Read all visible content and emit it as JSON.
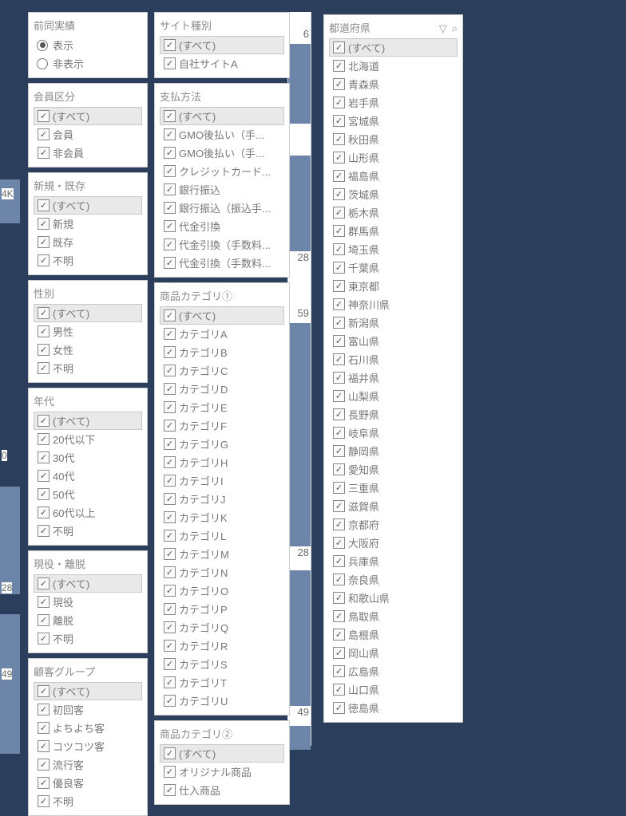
{
  "bg_numbers": {
    "n1": "4K",
    "n2": "0",
    "n3": "28",
    "n4": "49"
  },
  "right_numbers": {
    "r1": "6",
    "r2": "28",
    "r3": "59",
    "r4": "28",
    "r5": "49"
  },
  "panels": {
    "zenkai": {
      "title": "前同実績",
      "opt1": "表示",
      "opt2": "非表示"
    },
    "member": {
      "title": "会員区分",
      "all": "(すべて)",
      "items": [
        "会員",
        "非会員"
      ]
    },
    "shinki": {
      "title": "新規・既存",
      "all": "(すべて)",
      "items": [
        "新規",
        "既存",
        "不明"
      ]
    },
    "seibetsu": {
      "title": "性別",
      "all": "(すべて)",
      "items": [
        "男性",
        "女性",
        "不明"
      ]
    },
    "nendai": {
      "title": "年代",
      "all": "(すべて)",
      "items": [
        "20代以下",
        "30代",
        "40代",
        "50代",
        "60代以上",
        "不明"
      ]
    },
    "geneki": {
      "title": "現役・離脱",
      "all": "(すべて)",
      "items": [
        "現役",
        "離脱",
        "不明"
      ]
    },
    "group": {
      "title": "顧客グループ",
      "all": "(すべて)",
      "items": [
        "初回客",
        "よちよち客",
        "コツコツ客",
        "流行客",
        "優良客",
        "不明"
      ]
    },
    "site": {
      "title": "サイト種別",
      "all": "(すべて)",
      "items": [
        "自社サイトA"
      ]
    },
    "payment": {
      "title": "支払方法",
      "all": "(すべて)",
      "items": [
        "GMO後払い（手...",
        "GMO後払い（手...",
        "クレジットカード...",
        "銀行振込",
        "銀行振込（振込手...",
        "代金引換",
        "代金引換（手数料...",
        "代金引換（手数料..."
      ]
    },
    "cat1": {
      "title": "商品カテゴリ①",
      "all": "(すべて)",
      "items": [
        "カテゴリA",
        "カテゴリB",
        "カテゴリC",
        "カテゴリD",
        "カテゴリE",
        "カテゴリF",
        "カテゴリG",
        "カテゴリH",
        "カテゴリI",
        "カテゴリJ",
        "カテゴリK",
        "カテゴリL",
        "カテゴリM",
        "カテゴリN",
        "カテゴリO",
        "カテゴリP",
        "カテゴリQ",
        "カテゴリR",
        "カテゴリS",
        "カテゴリT",
        "カテゴリU"
      ]
    },
    "cat2": {
      "title": "商品カテゴリ②",
      "all": "(すべて)",
      "items": [
        "オリジナル商品",
        "仕入商品"
      ]
    },
    "pref": {
      "title": "都道府県",
      "all": "(すべて)",
      "items": [
        "北海道",
        "青森県",
        "岩手県",
        "宮城県",
        "秋田県",
        "山形県",
        "福島県",
        "茨城県",
        "栃木県",
        "群馬県",
        "埼玉県",
        "千葉県",
        "東京都",
        "神奈川県",
        "新潟県",
        "富山県",
        "石川県",
        "福井県",
        "山梨県",
        "長野県",
        "岐阜県",
        "静岡県",
        "愛知県",
        "三重県",
        "滋賀県",
        "京都府",
        "大阪府",
        "兵庫県",
        "奈良県",
        "和歌山県",
        "鳥取県",
        "島根県",
        "岡山県",
        "広島県",
        "山口県",
        "徳島県"
      ]
    }
  }
}
